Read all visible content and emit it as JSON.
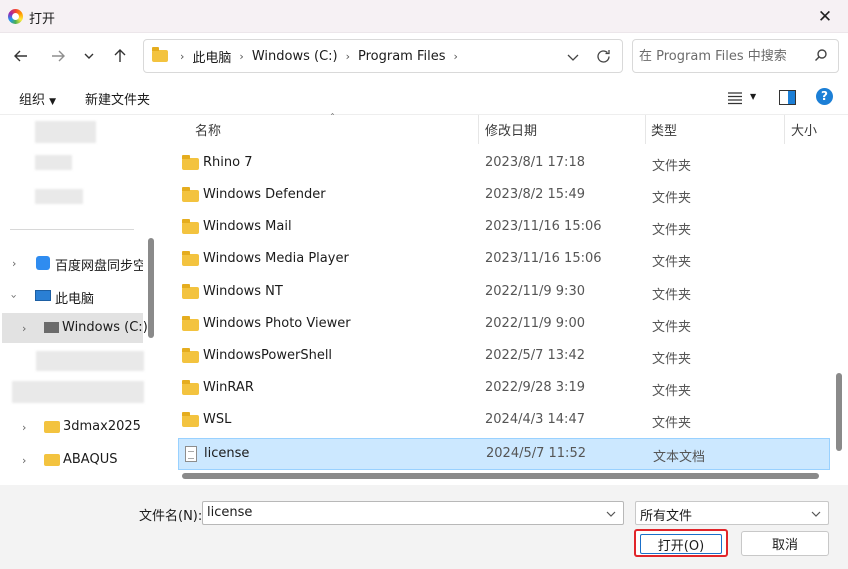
{
  "window": {
    "title": "打开",
    "close_glyph": "✕"
  },
  "address": {
    "crumbs": [
      "此电脑",
      "Windows (C:)",
      "Program Files"
    ],
    "separator": "›"
  },
  "search": {
    "placeholder": "在 Program Files 中搜索"
  },
  "toolbar": {
    "organize": "组织",
    "new_folder": "新建文件夹",
    "help": "?"
  },
  "nav": {
    "items": [
      {
        "label": "百度网盘同步空间"
      },
      {
        "label": "此电脑"
      },
      {
        "label": "Windows (C:)"
      },
      {
        "label": "3dmax2025"
      },
      {
        "label": "ABAQUS"
      }
    ]
  },
  "columns": {
    "name": "名称",
    "date": "修改日期",
    "type": "类型",
    "size": "大小"
  },
  "files": [
    {
      "name": "Rhino 7",
      "date": "2023/8/1 17:18",
      "type": "文件夹",
      "icon": "folder"
    },
    {
      "name": "Windows Defender",
      "date": "2023/8/2 15:49",
      "type": "文件夹",
      "icon": "folder"
    },
    {
      "name": "Windows Mail",
      "date": "2023/11/16 15:06",
      "type": "文件夹",
      "icon": "folder"
    },
    {
      "name": "Windows Media Player",
      "date": "2023/11/16 15:06",
      "type": "文件夹",
      "icon": "folder"
    },
    {
      "name": "Windows NT",
      "date": "2022/11/9 9:30",
      "type": "文件夹",
      "icon": "folder"
    },
    {
      "name": "Windows Photo Viewer",
      "date": "2022/11/9 9:00",
      "type": "文件夹",
      "icon": "folder"
    },
    {
      "name": "WindowsPowerShell",
      "date": "2022/5/7 13:42",
      "type": "文件夹",
      "icon": "folder"
    },
    {
      "name": "WinRAR",
      "date": "2022/9/28 3:19",
      "type": "文件夹",
      "icon": "folder"
    },
    {
      "name": "WSL",
      "date": "2024/4/3 14:47",
      "type": "文件夹",
      "icon": "folder"
    },
    {
      "name": "license",
      "date": "2024/5/7 11:52",
      "type": "文本文档",
      "icon": "text-document"
    }
  ],
  "footer": {
    "filename_label": "文件名(N):",
    "filename_value": "license",
    "filter_value": "所有文件",
    "open_label": "打开(O)",
    "cancel_label": "取消"
  },
  "colors": {
    "selection": "#cce8ff",
    "highlight_border": "#e1252a",
    "folder": "#f3c33f"
  }
}
